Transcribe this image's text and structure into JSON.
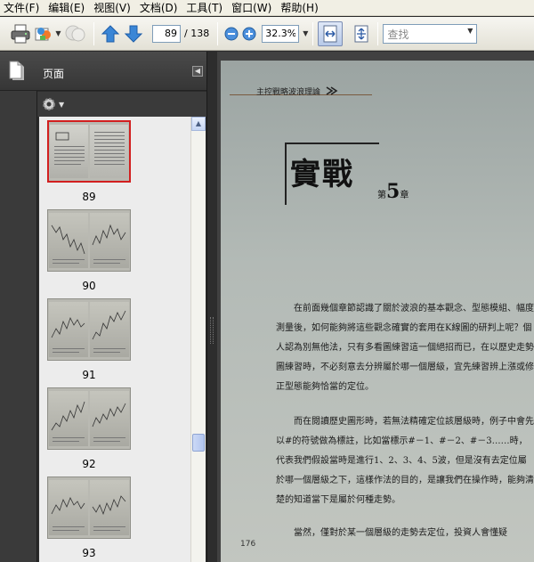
{
  "menu": [
    {
      "label": "文件(F)"
    },
    {
      "label": "编辑(E)"
    },
    {
      "label": "视图(V)"
    },
    {
      "label": "文档(D)"
    },
    {
      "label": "工具(T)"
    },
    {
      "label": "窗口(W)"
    },
    {
      "label": "帮助(H)"
    }
  ],
  "toolbar": {
    "current_page": "89",
    "total_pages": "/ 138",
    "zoom": "32.3%",
    "search_placeholder": "查找"
  },
  "panel": {
    "title": "页面"
  },
  "thumbnails": [
    {
      "page": "89",
      "selected": true
    },
    {
      "page": "90",
      "selected": false
    },
    {
      "page": "91",
      "selected": false
    },
    {
      "page": "92",
      "selected": false
    },
    {
      "page": "93",
      "selected": false
    }
  ],
  "document": {
    "running_head": "主控戰略波浪理論",
    "chapter_title": "實戰",
    "chapter_prefix": "第",
    "chapter_number": "5",
    "chapter_suffix": "章",
    "paragraphs": [
      "在前面幾個章節認識了關於波浪的基本觀念、型態模組、幅度測量後，如何能夠將這些觀念確實的套用在K線圖的研判上呢？個人認為別無他法，只有多看圖練習這一個絕招而已，在以歷史走勢圖練習時，不必刻意去分辨屬於哪一個層級，宜先練習辨上漲或修正型態能夠恰當的定位。",
      "而在閱讀歷史圖形時，若無法精確定位該層級時，例子中會先以#的符號做為標註，比如當標示#－1、#－2、#－3……時，代表我們假設當時是進行1、2、3、4、5波，但是沒有去定位屬於哪一個層級之下，這樣作法的目的，是讓我們在操作時，能夠清楚的知道當下是屬於何種走勢。",
      "當然，僅對於某一個層級的走勢去定位，投資人會懂疑"
    ],
    "page_number": "176"
  },
  "colors": {
    "selection_border": "#d21f1f",
    "panel_dark": "#3a3a3a",
    "toolbar_bg": "#e3e1d6"
  }
}
